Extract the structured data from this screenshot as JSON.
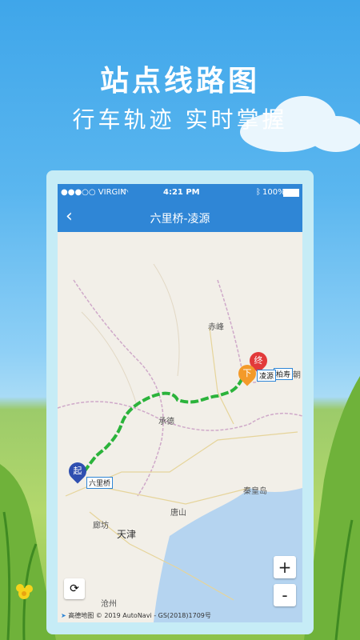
{
  "promo": {
    "headline": "站点线路图",
    "subline": "行车轨迹  实时掌握"
  },
  "status_bar": {
    "carrier": "●●●○○ VIRGIN",
    "wifi_icon": "wifi-icon",
    "time": "4:21 PM",
    "battery": "100%"
  },
  "nav": {
    "back_icon": "chevron-left-icon",
    "title": "六里桥-凌源"
  },
  "map": {
    "places": [
      "赤峰",
      "承德",
      "唐山",
      "廊坊",
      "天津",
      "秦皇岛",
      "沧州",
      "朝",
      "柏寿"
    ],
    "start": {
      "badge": "起",
      "label": "六里桥"
    },
    "alight": {
      "badge": "下",
      "label": "凌源"
    },
    "end": {
      "badge": "终"
    },
    "route_color": "#2bb33b",
    "zoom_in": "+",
    "zoom_out": "-",
    "attribution_logo": "高德地图",
    "attribution": "© 2019 AutoNavi - GS(2018)1709号"
  }
}
